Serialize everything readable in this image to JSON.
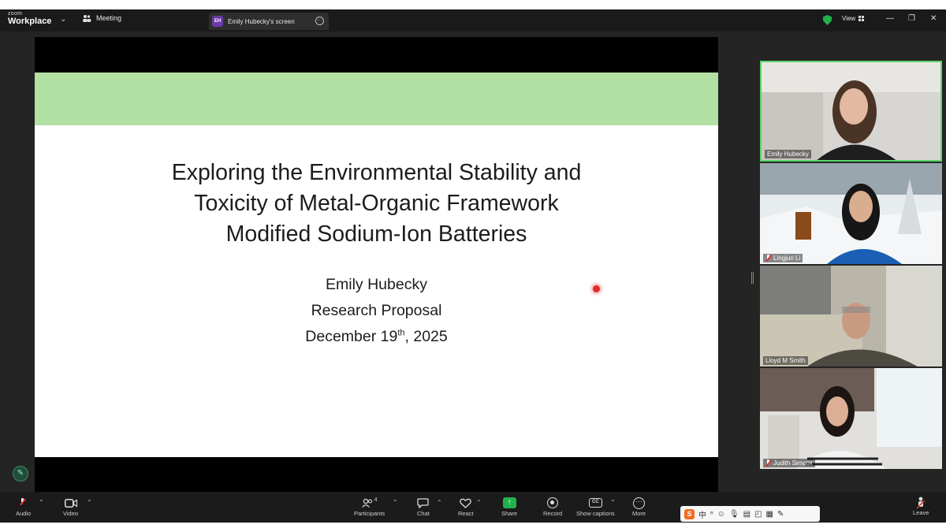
{
  "app": {
    "logo_line1": "zoom",
    "logo_line2": "Workplace",
    "meeting_tab_label": "Meeting",
    "share_tab_badge": "EH",
    "share_tab_label": "Emily Hubecky's screen",
    "view_label": "View",
    "accent_color": "#22b24c"
  },
  "slide": {
    "title_line1": "Exploring the Environmental Stability and",
    "title_line2": "Toxicity of Metal-Organic Framework",
    "title_line3": "Modified Sodium-Ion Batteries",
    "author": "Emily Hubecky",
    "doc_type": "Research Proposal",
    "date_prefix": "December 19",
    "date_sup": "th",
    "date_suffix": ", 2025",
    "band_color": "#b3e0a3"
  },
  "participants_tiles": [
    {
      "name": "Emily Hubecky",
      "active": true,
      "muted": false
    },
    {
      "name": "Lingjun Li",
      "active": false,
      "muted": true
    },
    {
      "name": "Lloyd M Smith",
      "active": false,
      "muted": false
    },
    {
      "name": "Judith Simcox",
      "active": false,
      "muted": true
    }
  ],
  "toolbar": {
    "audio": "Audio",
    "video": "Video",
    "participants": "Participants",
    "participants_count": "4",
    "chat": "Chat",
    "react": "React",
    "share": "Share",
    "record": "Record",
    "captions": "Show captions",
    "more": "More",
    "leave": "Leave"
  },
  "ime_bar": {
    "logo": "S",
    "lang": "中"
  }
}
